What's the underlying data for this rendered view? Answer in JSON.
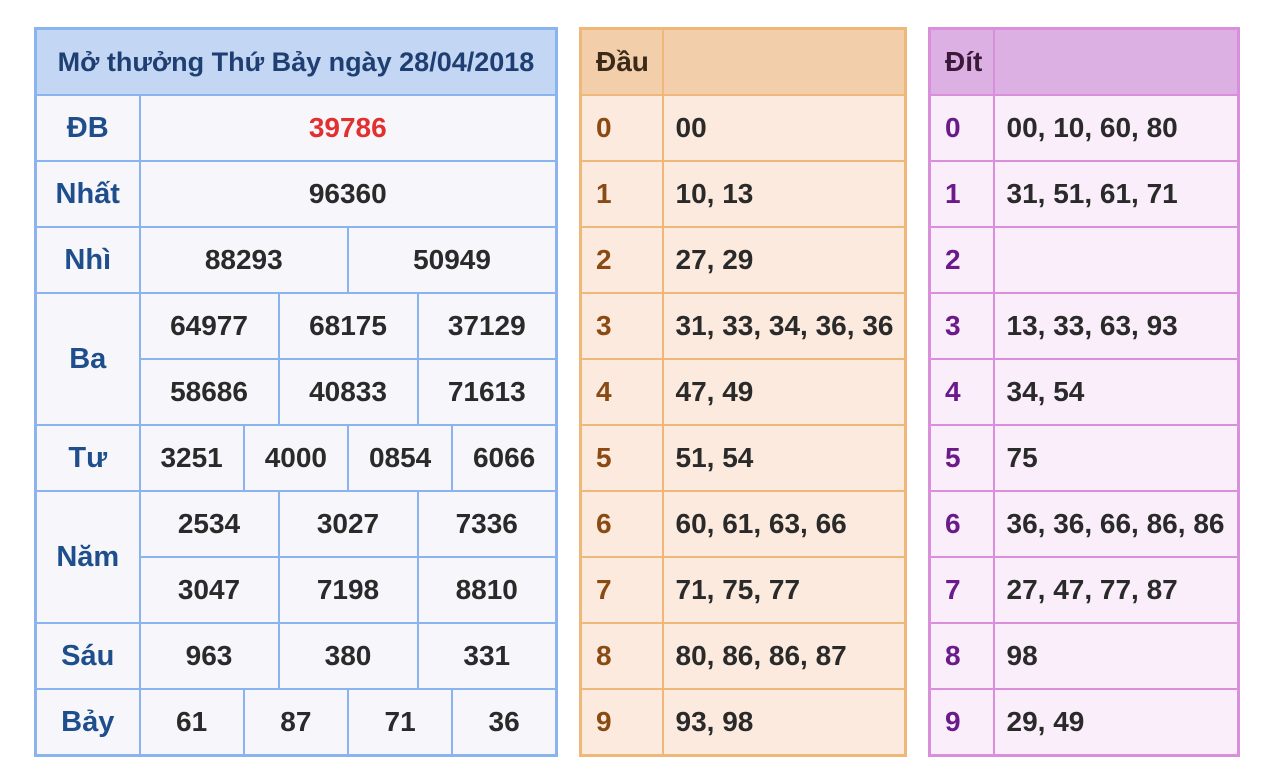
{
  "results": {
    "title": "Mở thưởng Thứ Bảy ngày 28/04/2018",
    "rows": {
      "db": {
        "label": "ĐB",
        "values": [
          "39786"
        ]
      },
      "nhat": {
        "label": "Nhất",
        "values": [
          "96360"
        ]
      },
      "nhi": {
        "label": "Nhì",
        "values": [
          "88293",
          "50949"
        ]
      },
      "ba": {
        "label": "Ba",
        "values": [
          "64977",
          "68175",
          "37129",
          "58686",
          "40833",
          "71613"
        ]
      },
      "tu": {
        "label": "Tư",
        "values": [
          "3251",
          "4000",
          "0854",
          "6066"
        ]
      },
      "nam": {
        "label": "Năm",
        "values": [
          "2534",
          "3027",
          "7336",
          "3047",
          "7198",
          "8810"
        ]
      },
      "sau": {
        "label": "Sáu",
        "values": [
          "963",
          "380",
          "331"
        ]
      },
      "bay": {
        "label": "Bảy",
        "values": [
          "61",
          "87",
          "71",
          "36"
        ]
      }
    },
    "colors": {
      "special": "#e23030",
      "rank": "#1f4e8c",
      "border": "#8ab4ef"
    }
  },
  "dau": {
    "header": "Đầu",
    "rows": [
      {
        "key": "0",
        "values": "00"
      },
      {
        "key": "1",
        "values": "10, 13"
      },
      {
        "key": "2",
        "values": "27, 29"
      },
      {
        "key": "3",
        "values": "31, 33, 34, 36, 36"
      },
      {
        "key": "4",
        "values": "47, 49"
      },
      {
        "key": "5",
        "values": "51, 54"
      },
      {
        "key": "6",
        "values": "60, 61, 63, 66"
      },
      {
        "key": "7",
        "values": "71, 75, 77"
      },
      {
        "key": "8",
        "values": "80, 86, 86, 87"
      },
      {
        "key": "9",
        "values": "93, 98"
      }
    ]
  },
  "dit": {
    "header": "Đít",
    "rows": [
      {
        "key": "0",
        "values": "00, 10, 60, 80"
      },
      {
        "key": "1",
        "values": "31, 51, 61, 71"
      },
      {
        "key": "2",
        "values": ""
      },
      {
        "key": "3",
        "values": "13, 33, 63, 93"
      },
      {
        "key": "4",
        "values": "34, 54"
      },
      {
        "key": "5",
        "values": "75"
      },
      {
        "key": "6",
        "values": "36, 36, 66, 86, 86"
      },
      {
        "key": "7",
        "values": "27, 47, 77, 87"
      },
      {
        "key": "8",
        "values": "98"
      },
      {
        "key": "9",
        "values": "29, 49"
      }
    ]
  }
}
